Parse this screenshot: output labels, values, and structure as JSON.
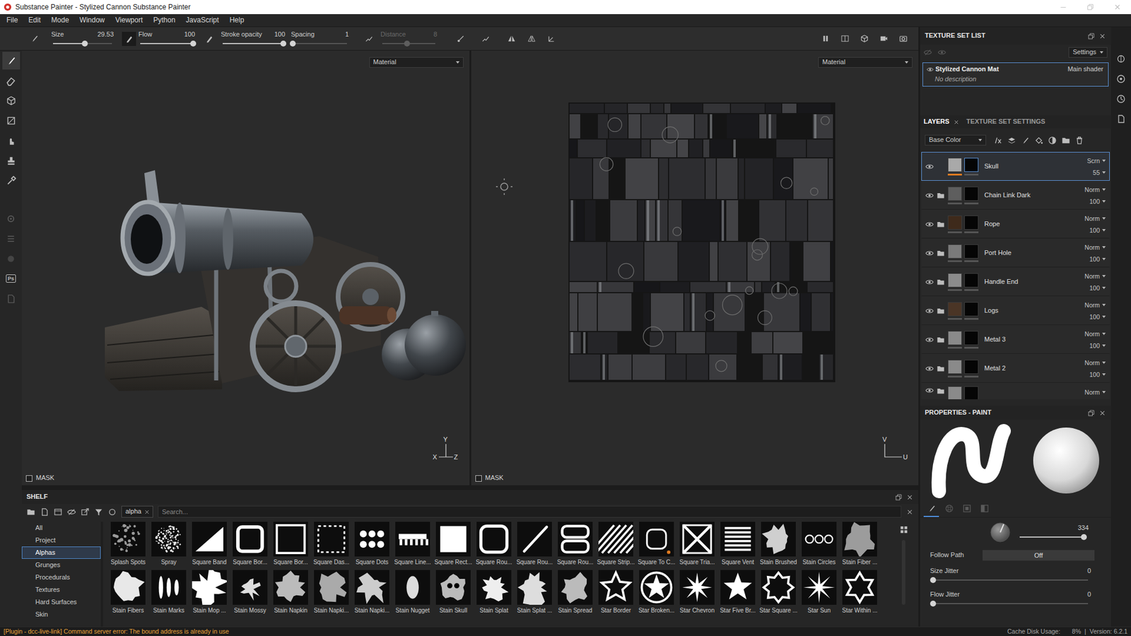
{
  "window": {
    "title": "Substance Painter - Stylized Cannon Substance Painter"
  },
  "menu": [
    "File",
    "Edit",
    "Mode",
    "Window",
    "Viewport",
    "Python",
    "JavaScript",
    "Help"
  ],
  "toolbar": {
    "sliders": [
      {
        "label": "Size",
        "value": "29.53",
        "level": 0.54,
        "disabled": false
      },
      {
        "label": "Flow",
        "value": "100",
        "level": 1,
        "disabled": false
      },
      {
        "label": "Stroke opacity",
        "value": "100",
        "level": 1,
        "disabled": false
      },
      {
        "label": "Spacing",
        "value": "1",
        "level": 0,
        "disabled": false
      },
      {
        "label": "Distance",
        "value": "8",
        "level": 0.47,
        "disabled": true
      }
    ]
  },
  "tools": [
    {
      "selected": true
    },
    {
      "selected": false
    },
    {
      "selected": false
    },
    {
      "selected": false
    },
    {
      "selected": false
    },
    {
      "selected": false
    },
    {
      "selected": false
    }
  ],
  "side_tools": [
    {
      "kind": "icon"
    },
    {
      "kind": "icon"
    },
    {
      "kind": "icon"
    },
    {
      "kind": "text",
      "label": "Ps"
    },
    {
      "kind": "icon"
    }
  ],
  "viewports": [
    {
      "kind": "3d",
      "mode": "Material",
      "mask_label": "MASK",
      "mask_checked": false,
      "axes": [
        "Y",
        "X",
        "Z"
      ]
    },
    {
      "kind": "uv",
      "mode": "Material",
      "mask_label": "MASK",
      "mask_checked": false,
      "axes": [
        "V",
        "U"
      ]
    }
  ],
  "texture_set_list": {
    "title": "TEXTURE SET LIST",
    "settings": "Settings",
    "items": [
      {
        "name": "Stylized Cannon Mat",
        "shader": "Main shader",
        "description": "No description",
        "selected": true,
        "visible": true
      }
    ]
  },
  "layers_panel": {
    "tabs": [
      {
        "label": "LAYERS",
        "selected": true
      },
      {
        "label": "TEXTURE SET SETTINGS",
        "selected": false
      }
    ],
    "channel": "Base Color",
    "layers": [
      {
        "name": "Skull",
        "kind": "paint",
        "blend": "Scrn",
        "opacity": "55",
        "visible": true,
        "selected": true,
        "color": "#a9a9a9"
      },
      {
        "name": "Chain Link Dark",
        "kind": "folder",
        "blend": "Norm",
        "opacity": "100",
        "visible": true,
        "selected": false,
        "color": "#5e5e5e"
      },
      {
        "name": "Rope",
        "kind": "folder",
        "blend": "Norm",
        "opacity": "100",
        "visible": true,
        "selected": false,
        "color": "#3e2a1b"
      },
      {
        "name": "Port Hole",
        "kind": "folder",
        "blend": "Norm",
        "opacity": "100",
        "visible": true,
        "selected": false,
        "color": "#7a7a7a"
      },
      {
        "name": "Handle End",
        "kind": "folder",
        "blend": "Norm",
        "opacity": "100",
        "visible": true,
        "selected": false,
        "color": "#8c8c8c"
      },
      {
        "name": "Logs",
        "kind": "folder",
        "blend": "Norm",
        "opacity": "100",
        "visible": true,
        "selected": false,
        "color": "#4a3526"
      },
      {
        "name": "Metal 3",
        "kind": "folder",
        "blend": "Norm",
        "opacity": "100",
        "visible": true,
        "selected": false,
        "color": "#8a8a8a"
      },
      {
        "name": "Metal 2",
        "kind": "folder",
        "blend": "Norm",
        "opacity": "100",
        "visible": true,
        "selected": false,
        "color": "#8a8a8a"
      }
    ],
    "partial_layer": {
      "kind": "folder",
      "blend": "Norm",
      "visible": true,
      "color": "#8a8a8a"
    }
  },
  "properties": {
    "title": "PROPERTIES - PAINT",
    "tabs": [
      {
        "selected": true
      },
      {
        "selected": false
      },
      {
        "selected": false
      },
      {
        "selected": false
      }
    ],
    "angle": {
      "value": "334",
      "level": 0.96
    },
    "follow_path": {
      "label": "Follow Path",
      "value": "Off"
    },
    "jitters": [
      {
        "label": "Size Jitter",
        "value": "0",
        "level": 0
      },
      {
        "label": "Flow Jitter",
        "value": "0",
        "level": 0
      }
    ]
  },
  "shelf": {
    "title": "SHELF",
    "filter": "alpha",
    "search": {
      "placeholder": "Search..."
    },
    "categories": [
      {
        "label": "All",
        "selected": false
      },
      {
        "label": "Project",
        "selected": false
      },
      {
        "label": "Alphas",
        "selected": true
      },
      {
        "label": "Grunges",
        "selected": false
      },
      {
        "label": "Procedurals",
        "selected": false
      },
      {
        "label": "Textures",
        "selected": false
      },
      {
        "label": "Hard Surfaces",
        "selected": false
      },
      {
        "label": "Skin",
        "selected": false
      }
    ],
    "items": [
      "Splash Spots",
      "Spray",
      "Square Band",
      "Square Bor...",
      "Square Bor...",
      "Square Das...",
      "Square Dots",
      "Square Line...",
      "Square Rect...",
      "Square Rou...",
      "Square Rou...",
      "Square Rou...",
      "Square Strip...",
      "Square To C...",
      "Square Tria...",
      "Square Vent",
      "Stain Brushed",
      "Stain Circles",
      "Stain Fiber ...",
      "Stain Fibers",
      "Stain Marks",
      "Stain Mop ...",
      "Stain Mossy",
      "Stain Napkin",
      "Stain Napki...",
      "Stain Napki...",
      "Stain Nugget",
      "Stain Skull",
      "Stain Splat",
      "Stain Splat ...",
      "Stain Spread",
      "Star Border",
      "Star Broken...",
      "Star Chevron",
      "Star Five Br...",
      "Star Square ...",
      "Star Sun",
      "Star Within ..."
    ]
  },
  "status_bar": {
    "message": "[Plugin - dcc-live-link] Command server error: The bound address is already in use",
    "cache_label": "Cache Disk Usage:",
    "cache_value": "8%",
    "separator": "|",
    "version": "Version: 6.2.1"
  }
}
